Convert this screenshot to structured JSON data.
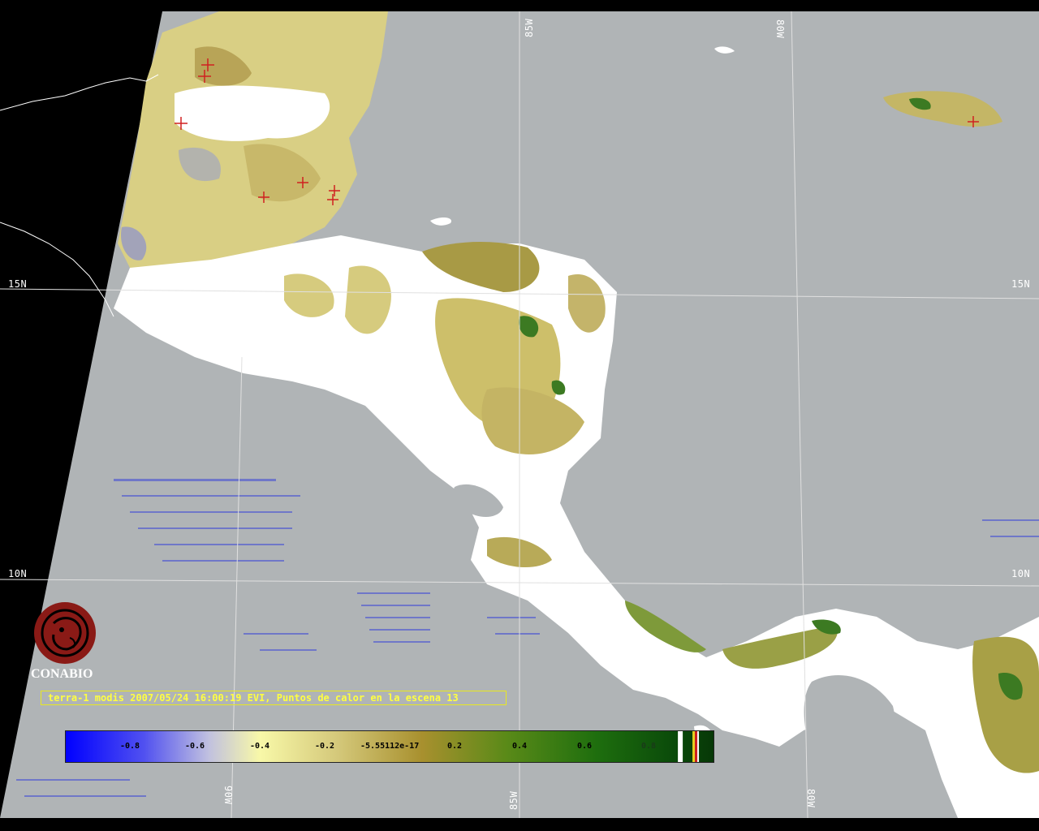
{
  "caption": "terra-1 modis 2007/05/24 16:00:19 EVI, Puntos de calor en la escena 13",
  "logo": {
    "name": "CONABIO"
  },
  "grid_labels": {
    "lat_15_left": "15N",
    "lat_15_right": "15N",
    "lat_10_left": "10N",
    "lat_10_right": "10N",
    "lon_85_top": "85W",
    "lon_80_top": "80W",
    "lon_90_bottom": "90W",
    "lon_85_bottom": "85W",
    "lon_80_bottom": "80W"
  },
  "colorbar": {
    "ticks": [
      "-0.8",
      "-0.6",
      "-0.4",
      "-0.2",
      "-5.55112e-17",
      "0.2",
      "0.4",
      "0.6",
      "0.8"
    ],
    "colors": [
      "#1010ff",
      "#8080e0",
      "#f5f5a0",
      "#c8b870",
      "#a08830",
      "#6a8a1a",
      "#2a7a10",
      "#0a4a0a"
    ]
  },
  "colors": {
    "ocean": "#b0b4b6",
    "cloud": "#ffffff",
    "land_low": "#d8cf80",
    "land_mid": "#b8a850",
    "land_high": "#3c7a22",
    "hotspot": "#d02020",
    "gridline": "#e0e0e0"
  }
}
